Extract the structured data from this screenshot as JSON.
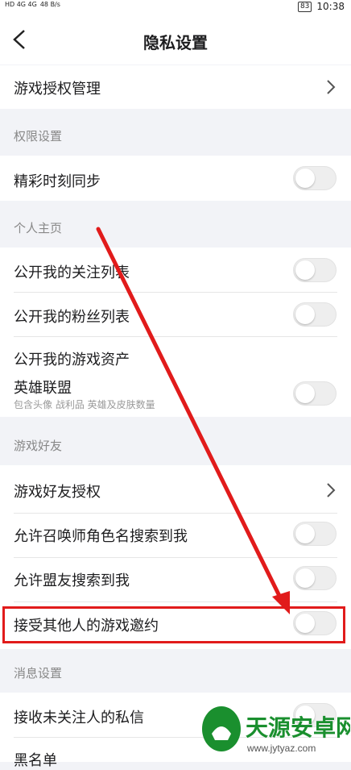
{
  "status": {
    "signal_left": "HD 4G 4G",
    "speed": "48 B/s",
    "battery": "83",
    "time": "10:38"
  },
  "header": {
    "title": "隐私设置"
  },
  "rows": {
    "game_auth": "游戏授权管理",
    "perm_section": "权限设置",
    "highlight_sync": "精彩时刻同步",
    "profile_section": "个人主页",
    "public_follow": "公开我的关注列表",
    "public_fans": "公开我的粉丝列表",
    "public_assets": "公开我的游戏资产",
    "lol": "英雄联盟",
    "lol_sub": "包含头像 战利品 英雄及皮肤数量",
    "friends_section": "游戏好友",
    "friend_auth": "游戏好友授权",
    "search_summoner": "允许召唤师角色名搜索到我",
    "search_ally": "允许盟友搜索到我",
    "accept_invite": "接受其他人的游戏邀约",
    "msg_section": "消息设置",
    "private_msg": "接收未关注人的私信",
    "blacklist": "黑名单"
  },
  "watermark": {
    "name": "天源安卓网",
    "url": "www.jytyaz.com"
  },
  "colors": {
    "accent": "#e11b1b"
  }
}
